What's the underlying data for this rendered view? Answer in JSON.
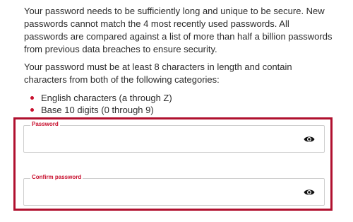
{
  "intro_text": "Your password needs to be sufficiently long and unique to be secure. New passwords cannot match the 4 most recently used passwords. All passwords are compared against a list of more than half a billion passwords from previous data breaches to ensure security.",
  "requirements_text": "Your password must be at least 8 characters in length and contain characters from both of the following categories:",
  "categories": [
    "English characters (a through Z)",
    "Base 10 digits (0 through 9)"
  ],
  "fields": {
    "password": {
      "label": "Password",
      "value": "",
      "icon": "eye-icon"
    },
    "confirm": {
      "label": "Confirm password",
      "value": "",
      "icon": "eye-icon"
    }
  },
  "colors": {
    "accent": "#c8102e",
    "highlight_border": "#b0102e",
    "field_border": "#cfcfcf",
    "text": "#2b2b2b"
  }
}
